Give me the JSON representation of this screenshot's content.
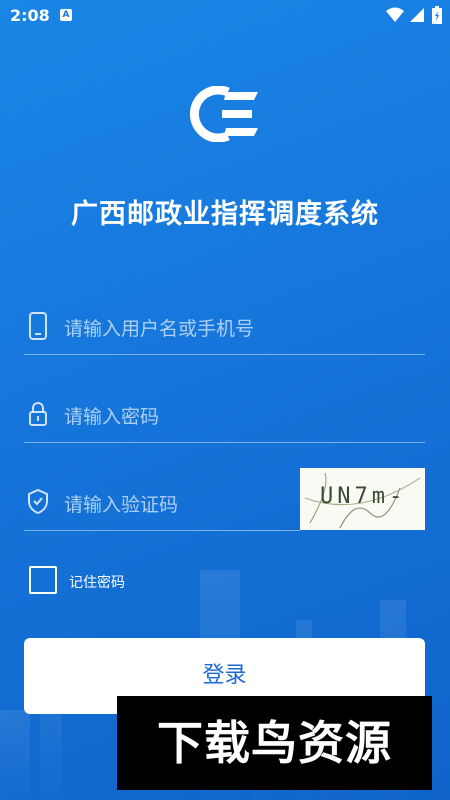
{
  "status_bar": {
    "time": "2:08",
    "notification_badge": "A"
  },
  "app": {
    "logo_icon": "gz-logo-icon",
    "title": "广西邮政业指挥调度系统"
  },
  "form": {
    "username": {
      "placeholder": "请输入用户名或手机号",
      "icon": "phone-icon"
    },
    "password": {
      "placeholder": "请输入密码",
      "icon": "lock-icon"
    },
    "captcha_input": {
      "placeholder": "请输入验证码",
      "icon": "shield-check-icon"
    },
    "captcha_image_text": "UN7m-",
    "remember_label": "记住密码",
    "remember_checked": false,
    "login_label": "登录"
  },
  "watermark": "下载鸟资源",
  "colors": {
    "background_start": "#1a86e6",
    "background_end": "#0f63c9",
    "button_bg": "#ffffff",
    "button_text": "#1d6ad6"
  }
}
